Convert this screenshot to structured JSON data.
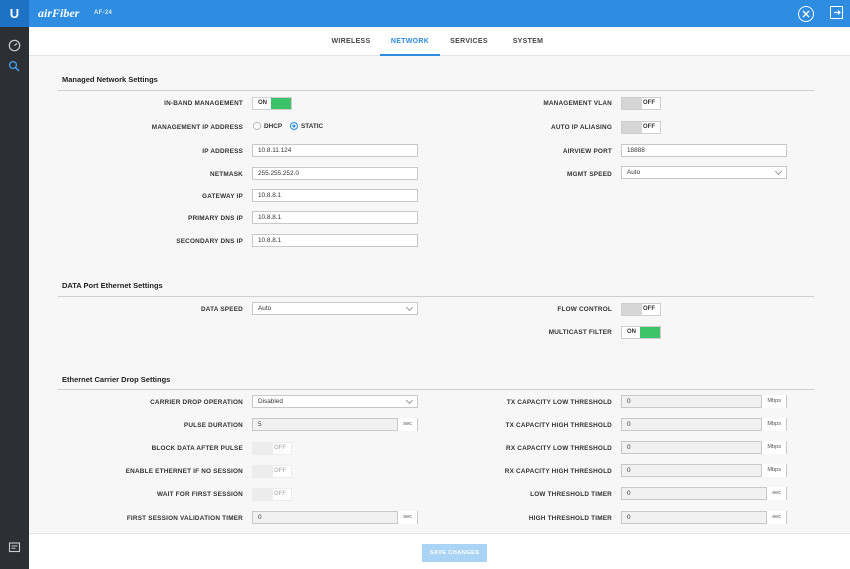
{
  "topbar": {
    "brand": "airFiber",
    "device": "AF-24",
    "logo_letter": "U"
  },
  "tabs": [
    {
      "label": "WIRELESS"
    },
    {
      "label": "NETWORK"
    },
    {
      "label": "SERVICES"
    },
    {
      "label": "SYSTEM"
    }
  ],
  "active_tab": "NETWORK",
  "icons": {
    "tools": "tools-icon",
    "logout": "logout-icon",
    "dashboard": "dashboard-icon",
    "search": "search-icon",
    "console": "console-icon"
  },
  "colors": {
    "accent": "#2e8de0",
    "sidebar": "#2c3034",
    "toggle_on": "#3cc36a"
  },
  "managed": {
    "title": "Managed Network Settings",
    "inband_label": "IN-BAND MANAGEMENT",
    "inband_state": "ON",
    "mgmt_ip_label": "MANAGEMENT IP ADDRESS",
    "dhcp": "DHCP",
    "static": "STATIC",
    "mode_selected": "STATIC",
    "ip_label": "IP ADDRESS",
    "ip": "10.8.11.124",
    "netmask_label": "NETMASK",
    "netmask": "255.255.252.0",
    "gateway_label": "GATEWAY IP",
    "gateway": "10.8.8.1",
    "dns1_label": "PRIMARY DNS IP",
    "dns1": "10.8.8.1",
    "dns2_label": "SECONDARY DNS IP",
    "dns2": "10.8.8.1",
    "vlan_label": "MANAGEMENT VLAN",
    "vlan_state": "OFF",
    "aliasing_label": "AUTO IP ALIASING",
    "aliasing_state": "OFF",
    "airview_label": "AIRVIEW PORT",
    "airview_port": "18888",
    "mgmt_speed_label": "MGMT SPEED",
    "mgmt_speed": "Auto"
  },
  "dataport": {
    "title": "DATA Port Ethernet Settings",
    "speed_label": "DATA SPEED",
    "speed": "Auto",
    "flow_label": "FLOW CONTROL",
    "flow_state": "OFF",
    "multicast_label": "MULTICAST FILTER",
    "multicast_state": "ON"
  },
  "carrier": {
    "title": "Ethernet Carrier Drop Settings",
    "operation_label": "CARRIER DROP OPERATION",
    "operation": "Disabled",
    "pulse_label": "PULSE DURATION",
    "pulse": "5",
    "pulse_unit": "sec",
    "block_label": "BLOCK DATA AFTER PULSE",
    "block_state": "OFF",
    "enable_eth_label": "ENABLE ETHERNET IF NO SESSION",
    "enable_eth_state": "OFF",
    "wait_label": "WAIT FOR FIRST SESSION",
    "wait_state": "OFF",
    "first_timer_label": "FIRST SESSION VALIDATION TIMER",
    "first_timer": "0",
    "first_timer_unit": "sec",
    "tx_low_label": "TX CAPACITY LOW THRESHOLD",
    "tx_low": "0",
    "tx_low_unit": "Mbps",
    "tx_high_label": "TX CAPACITY HIGH THRESHOLD",
    "tx_high": "0",
    "tx_high_unit": "Mbps",
    "rx_low_label": "RX CAPACITY LOW THRESHOLD",
    "rx_low": "0",
    "rx_low_unit": "Mbps",
    "rx_high_label": "RX CAPACITY HIGH THRESHOLD",
    "rx_high": "0",
    "rx_high_unit": "Mbps",
    "low_timer_label": "LOW THRESHOLD TIMER",
    "low_timer": "0",
    "low_timer_unit": "sec",
    "high_timer_label": "HIGH THRESHOLD TIMER",
    "high_timer": "0",
    "high_timer_unit": "sec"
  },
  "save_label": "SAVE CHANGES"
}
